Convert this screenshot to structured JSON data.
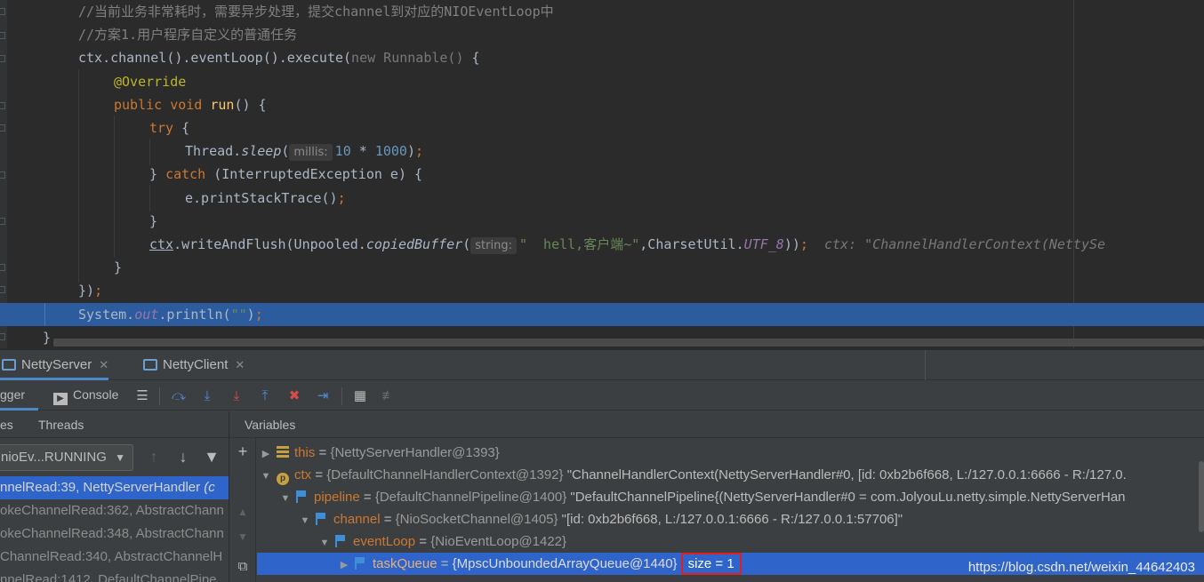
{
  "editor": {
    "lines": [
      {
        "indent": 2,
        "parts": [
          {
            "t": "//当前业务非常耗时，需要异步处理，提交channel到对应的NIOEventLoop中",
            "c": "cm"
          }
        ]
      },
      {
        "indent": 2,
        "parts": [
          {
            "t": "//方案1.用户程序自定义的普通任务",
            "c": "cm"
          }
        ]
      },
      {
        "indent": 2,
        "parts": [
          {
            "t": "ctx.channel().eventLoop().execute("
          },
          {
            "t": "new ",
            "c": "gy"
          },
          {
            "t": "Runnable()",
            "c": "gy"
          },
          {
            "t": " {"
          }
        ]
      },
      {
        "indent": 3,
        "parts": [
          {
            "t": "@Override",
            "c": "an"
          }
        ]
      },
      {
        "indent": 3,
        "parts": [
          {
            "t": "public ",
            "c": "kw"
          },
          {
            "t": "void ",
            "c": "kw"
          },
          {
            "t": "run",
            "c": "fn"
          },
          {
            "t": "() {"
          }
        ]
      },
      {
        "indent": 4,
        "parts": [
          {
            "t": "try ",
            "c": "kw"
          },
          {
            "t": "{"
          }
        ]
      },
      {
        "indent": 5,
        "parts": [
          {
            "t": "Thread."
          },
          {
            "t": "sleep",
            "c": "it"
          },
          {
            "t": "("
          },
          {
            "hint": "millis:"
          },
          {
            "t": "10",
            "c": "nm"
          },
          {
            "t": " * "
          },
          {
            "t": "1000",
            "c": "nm"
          },
          {
            "t": ")"
          },
          {
            "t": ";",
            "c": "kw"
          }
        ]
      },
      {
        "indent": 4,
        "parts": [
          {
            "t": "} "
          },
          {
            "t": "catch ",
            "c": "kw"
          },
          {
            "t": "(InterruptedException e) {"
          }
        ]
      },
      {
        "indent": 5,
        "parts": [
          {
            "t": "e.printStackTrace()"
          },
          {
            "t": ";",
            "c": "kw"
          }
        ]
      },
      {
        "indent": 4,
        "parts": [
          {
            "t": "}"
          }
        ]
      },
      {
        "indent": 4,
        "parts": [
          {
            "t": "ctx",
            "c": "ul"
          },
          {
            "t": ".writeAndFlush(Unpooled."
          },
          {
            "t": "copiedBuffer",
            "c": "it"
          },
          {
            "t": "("
          },
          {
            "hint": "string:"
          },
          {
            "t": "\"  hell,客户端~\"",
            "c": "st"
          },
          {
            "t": ",CharsetUtil."
          },
          {
            "t": "UTF_8",
            "c": "fd"
          },
          {
            "t": "))"
          },
          {
            "t": ";",
            "c": "kw"
          },
          {
            "t": "  ctx: \"ChannelHandlerContext(NettySe",
            "c": "inline-val"
          }
        ]
      },
      {
        "indent": 3,
        "parts": [
          {
            "t": "}"
          }
        ]
      },
      {
        "indent": 2,
        "parts": [
          {
            "t": "})"
          },
          {
            "t": ";",
            "c": "kw"
          }
        ]
      },
      {
        "indent": 2,
        "hl": true,
        "parts": [
          {
            "t": "System."
          },
          {
            "t": "out",
            "c": "fd"
          },
          {
            "t": ".println("
          },
          {
            "t": "\"\"",
            "c": "st"
          },
          {
            "t": ")"
          },
          {
            "t": ";",
            "c": "kw"
          }
        ]
      },
      {
        "indent": 1,
        "parts": [
          {
            "t": "}"
          }
        ]
      }
    ]
  },
  "run_tabs": [
    {
      "label": "NettyServer",
      "active": true
    },
    {
      "label": "NettyClient",
      "active": false
    }
  ],
  "toolbar": {
    "debugger_label": "gger",
    "console_label": "Console",
    "icons": [
      "menu-icon",
      "step-over-icon",
      "step-into-icon",
      "force-step-into-icon",
      "step-out-icon",
      "drop-frame-icon",
      "run-to-cursor-icon",
      "evaluate-icon",
      "trace-icon"
    ]
  },
  "frames": {
    "tab_frames": "es",
    "tab_threads": "Threads",
    "thread_value": "nioEv...RUNNING",
    "rows": [
      {
        "method": "nnelRead:39, NettyServerHandler",
        "lib": " (c",
        "selected": true
      },
      {
        "method": "okeChannelRead:362, AbstractChann",
        "lib": "",
        "selected": false
      },
      {
        "method": "okeChannelRead:348, AbstractChann",
        "lib": "",
        "selected": false
      },
      {
        "method": "ChannelRead:340, AbstractChannelH",
        "lib": "",
        "selected": false
      },
      {
        "method": "nnelRead:1412, DefaultChannelPipe",
        "lib": "",
        "selected": false
      }
    ]
  },
  "variables": {
    "header": "Variables",
    "rows": [
      {
        "depth": 0,
        "toggle": "▶",
        "icon": "bars",
        "name": "this",
        "type": "{NettyServerHandler@1393}",
        "value": ""
      },
      {
        "depth": 0,
        "toggle": "▼",
        "icon": "p",
        "name": "ctx",
        "type": "{DefaultChannelHandlerContext@1392}",
        "value": " \"ChannelHandlerContext(NettyServerHandler#0, [id: 0xb2b6f668, L:/127.0.0.1:6666 - R:/127.0."
      },
      {
        "depth": 1,
        "toggle": "▼",
        "icon": "flag",
        "name": "pipeline",
        "type": "{DefaultChannelPipeline@1400}",
        "value": " \"DefaultChannelPipeline{(NettyServerHandler#0 = com.JolyouLu.netty.simple.NettyServerHan"
      },
      {
        "depth": 2,
        "toggle": "▼",
        "icon": "flag",
        "name": "channel",
        "type": "{NioSocketChannel@1405}",
        "value": " \"[id: 0xb2b6f668, L:/127.0.0.1:6666 - R:/127.0.0.1:57706]\""
      },
      {
        "depth": 3,
        "toggle": "▼",
        "icon": "flag",
        "name": "eventLoop",
        "type": "{NioEventLoop@1422}",
        "value": ""
      },
      {
        "depth": 4,
        "toggle": "▶",
        "icon": "flag",
        "name": "taskQueue",
        "type": "{MpscUnboundedArrayQueue@1440}",
        "value": "",
        "size": "size = 1",
        "selected": true
      }
    ],
    "watermark": "https://blog.csdn.net/weixin_44642403"
  },
  "colors": {
    "accent": "#2f65ca",
    "highlight_line": "#2d5c9e",
    "annotation_box": "#e02020"
  }
}
